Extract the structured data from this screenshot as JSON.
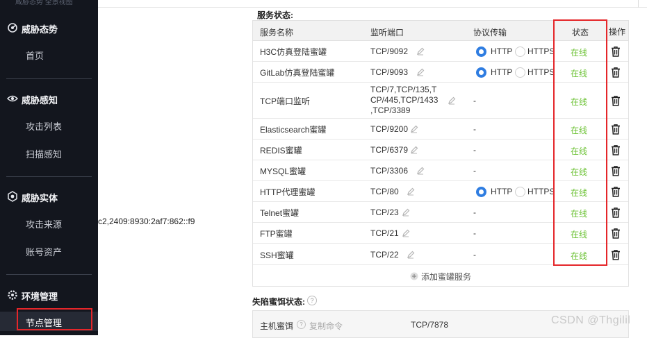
{
  "sidebar": {
    "top_text": "威胁态势 全景视图",
    "groups": [
      {
        "label": "威胁态势",
        "icon": "radar-icon",
        "items": [
          {
            "label": "首页"
          }
        ]
      },
      {
        "label": "威胁感知",
        "icon": "eye-icon",
        "items": [
          {
            "label": "攻击列表"
          },
          {
            "label": "扫描感知"
          }
        ]
      },
      {
        "label": "威胁实体",
        "icon": "hexagon-icon",
        "items": [
          {
            "label": "攻击来源"
          },
          {
            "label": "账号资产"
          }
        ]
      },
      {
        "label": "环境管理",
        "icon": "settings-icon",
        "items": [
          {
            "label": "节点管理",
            "active": true
          }
        ]
      }
    ]
  },
  "ipv6_fragment": "c2,2409:8930:2af7:862::f9",
  "services": {
    "title": "服务状态:",
    "headers": {
      "name": "服务名称",
      "port": "监听端口",
      "protocol": "协议传输",
      "status": "状态",
      "action": "操作"
    },
    "rows": [
      {
        "name": "H3C仿真登陆蜜罐",
        "port": "TCP/9092",
        "protocol": "radio",
        "selected": "HTTP",
        "status": "在线"
      },
      {
        "name": "GitLab仿真登陆蜜罐",
        "port": "TCP/9093",
        "protocol": "radio",
        "selected": "HTTP",
        "status": "在线"
      },
      {
        "name": "TCP端口监听",
        "port_lines": [
          "TCP/7,TCP/135,T",
          "CP/445,TCP/1433",
          ",TCP/3389"
        ],
        "protocol": "-",
        "status": "在线"
      },
      {
        "name": "Elasticsearch蜜罐",
        "port": "TCP/9200",
        "protocol": "-",
        "status": "在线"
      },
      {
        "name": "REDIS蜜罐",
        "port": "TCP/6379",
        "protocol": "-",
        "status": "在线"
      },
      {
        "name": "MYSQL蜜罐",
        "port": "TCP/3306",
        "protocol": "-",
        "status": "在线"
      },
      {
        "name": "HTTP代理蜜罐",
        "port": "TCP/80",
        "protocol": "radio",
        "selected": "HTTP",
        "status": "在线"
      },
      {
        "name": "Telnet蜜罐",
        "port": "TCP/23",
        "protocol": "-",
        "status": "在线"
      },
      {
        "name": "FTP蜜罐",
        "port": "TCP/21",
        "protocol": "-",
        "status": "在线"
      },
      {
        "name": "SSH蜜罐",
        "port": "TCP/22",
        "protocol": "-",
        "status": "在线"
      }
    ],
    "protocol_options": [
      "HTTP",
      "HTTPS"
    ],
    "add_label": "添加蜜罐服务"
  },
  "trap": {
    "title": "失陷蜜饵状态:",
    "rows": [
      {
        "name": "主机蜜饵",
        "copy_label": "复制命令",
        "port": "TCP/7878"
      }
    ]
  },
  "watermark": "CSDN @Thgilil",
  "colors": {
    "online": "#6cc234",
    "radio_selected": "#2f7de1",
    "highlight_box": "#e5262a",
    "sidebar_bg": "#13161e"
  }
}
